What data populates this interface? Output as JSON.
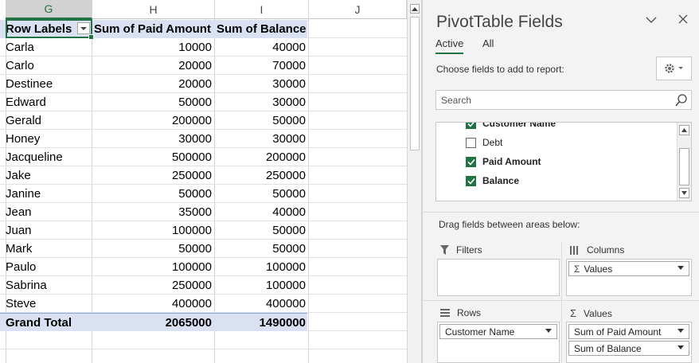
{
  "sheet": {
    "columns": [
      "G",
      "H",
      "I",
      "J"
    ],
    "header_row": [
      "Row Labels",
      "Sum of Paid Amount",
      "Sum of Balance"
    ],
    "rows": [
      [
        "Carla",
        "10000",
        "40000"
      ],
      [
        "Carlo",
        "20000",
        "70000"
      ],
      [
        "Destinee",
        "20000",
        "30000"
      ],
      [
        "Edward",
        "50000",
        "30000"
      ],
      [
        "Gerald",
        "200000",
        "50000"
      ],
      [
        "Honey",
        "30000",
        "30000"
      ],
      [
        "Jacqueline",
        "500000",
        "200000"
      ],
      [
        "Jake",
        "250000",
        "250000"
      ],
      [
        "Janine",
        "50000",
        "50000"
      ],
      [
        "Jean",
        "35000",
        "40000"
      ],
      [
        "Juan",
        "100000",
        "50000"
      ],
      [
        "Mark",
        "50000",
        "50000"
      ],
      [
        "Paulo",
        "100000",
        "100000"
      ],
      [
        "Sabrina",
        "250000",
        "100000"
      ],
      [
        "Steve",
        "400000",
        "400000"
      ]
    ],
    "total_row": [
      "Grand Total",
      "2065000",
      "1490000"
    ],
    "header_fill": "#d9e1f2",
    "selection_color": "#217346"
  },
  "pane": {
    "title": "PivotTable Fields",
    "tabs": [
      "Active",
      "All"
    ],
    "choose_label": "Choose fields to add to report:",
    "search_placeholder": "Search",
    "fields": [
      {
        "label": "Customer Name",
        "checked": true
      },
      {
        "label": "Debt",
        "checked": false
      },
      {
        "label": "Paid Amount",
        "checked": true
      },
      {
        "label": "Balance",
        "checked": true
      }
    ],
    "drag_label": "Drag fields between areas below:",
    "areas": {
      "filters": {
        "label": "Filters",
        "items": []
      },
      "columns": {
        "label": "Columns",
        "items": [
          "Values"
        ]
      },
      "rows": {
        "label": "Rows",
        "items": [
          "Customer Name"
        ]
      },
      "values": {
        "label": "Values",
        "items": [
          "Sum of Paid Amount",
          "Sum of Balance"
        ]
      }
    },
    "icons": [
      "chevron-down-icon",
      "close-icon",
      "gear-icon",
      "search-icon",
      "filter-icon",
      "columns-icon",
      "rows-icon",
      "sigma-icon"
    ]
  }
}
